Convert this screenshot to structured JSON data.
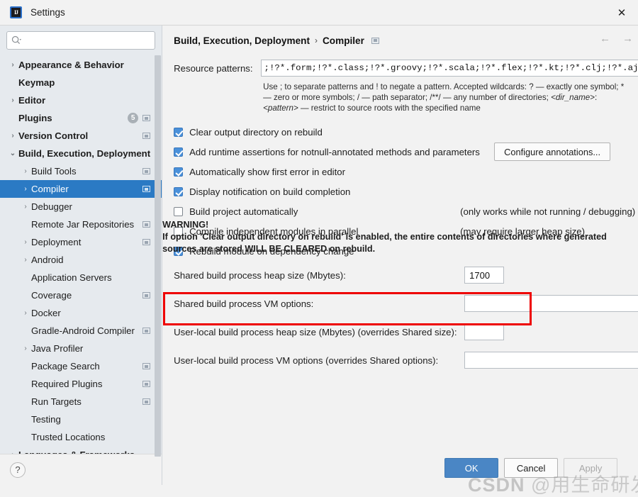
{
  "window": {
    "title": "Settings",
    "app_icon": "intellij-idea-icon",
    "close_label": "✕"
  },
  "sidebar": {
    "search": {
      "value": "",
      "placeholder": "",
      "icon": "search-icon"
    },
    "items": [
      {
        "label": "Appearance & Behavior",
        "arrow": "›",
        "bold": true,
        "indent": 0,
        "monitor": false,
        "badge": null,
        "selected": false
      },
      {
        "label": "Keymap",
        "arrow": "",
        "bold": true,
        "indent": 0,
        "monitor": false,
        "badge": null,
        "selected": false
      },
      {
        "label": "Editor",
        "arrow": "›",
        "bold": true,
        "indent": 0,
        "monitor": false,
        "badge": null,
        "selected": false
      },
      {
        "label": "Plugins",
        "arrow": "",
        "bold": true,
        "indent": 0,
        "monitor": true,
        "badge": "5",
        "selected": false
      },
      {
        "label": "Version Control",
        "arrow": "›",
        "bold": true,
        "indent": 0,
        "monitor": true,
        "badge": null,
        "selected": false
      },
      {
        "label": "Build, Execution, Deployment",
        "arrow": "⌄",
        "bold": true,
        "indent": 0,
        "monitor": false,
        "badge": null,
        "selected": false
      },
      {
        "label": "Build Tools",
        "arrow": "›",
        "bold": false,
        "indent": 1,
        "monitor": true,
        "badge": null,
        "selected": false
      },
      {
        "label": "Compiler",
        "arrow": "›",
        "bold": false,
        "indent": 1,
        "monitor": true,
        "badge": null,
        "selected": true
      },
      {
        "label": "Debugger",
        "arrow": "›",
        "bold": false,
        "indent": 1,
        "monitor": false,
        "badge": null,
        "selected": false
      },
      {
        "label": "Remote Jar Repositories",
        "arrow": "",
        "bold": false,
        "indent": 1,
        "monitor": true,
        "badge": null,
        "selected": false
      },
      {
        "label": "Deployment",
        "arrow": "›",
        "bold": false,
        "indent": 1,
        "monitor": true,
        "badge": null,
        "selected": false
      },
      {
        "label": "Android",
        "arrow": "›",
        "bold": false,
        "indent": 1,
        "monitor": false,
        "badge": null,
        "selected": false
      },
      {
        "label": "Application Servers",
        "arrow": "",
        "bold": false,
        "indent": 1,
        "monitor": false,
        "badge": null,
        "selected": false
      },
      {
        "label": "Coverage",
        "arrow": "",
        "bold": false,
        "indent": 1,
        "monitor": true,
        "badge": null,
        "selected": false
      },
      {
        "label": "Docker",
        "arrow": "›",
        "bold": false,
        "indent": 1,
        "monitor": false,
        "badge": null,
        "selected": false
      },
      {
        "label": "Gradle-Android Compiler",
        "arrow": "",
        "bold": false,
        "indent": 1,
        "monitor": true,
        "badge": null,
        "selected": false
      },
      {
        "label": "Java Profiler",
        "arrow": "›",
        "bold": false,
        "indent": 1,
        "monitor": false,
        "badge": null,
        "selected": false
      },
      {
        "label": "Package Search",
        "arrow": "",
        "bold": false,
        "indent": 1,
        "monitor": true,
        "badge": null,
        "selected": false
      },
      {
        "label": "Required Plugins",
        "arrow": "",
        "bold": false,
        "indent": 1,
        "monitor": true,
        "badge": null,
        "selected": false
      },
      {
        "label": "Run Targets",
        "arrow": "",
        "bold": false,
        "indent": 1,
        "monitor": true,
        "badge": null,
        "selected": false
      },
      {
        "label": "Testing",
        "arrow": "",
        "bold": false,
        "indent": 1,
        "monitor": false,
        "badge": null,
        "selected": false
      },
      {
        "label": "Trusted Locations",
        "arrow": "",
        "bold": false,
        "indent": 1,
        "monitor": false,
        "badge": null,
        "selected": false
      },
      {
        "label": "Languages & Frameworks",
        "arrow": "›",
        "bold": true,
        "indent": 0,
        "monitor": false,
        "badge": null,
        "selected": false
      }
    ],
    "help_button": "?"
  },
  "header": {
    "breadcrumb_root": "Build, Execution, Deployment",
    "breadcrumb_sep": "›",
    "breadcrumb_leaf": "Compiler",
    "project_scope_icon": "project-scope-icon",
    "back_arrow": "←",
    "forward_arrow": "→"
  },
  "main": {
    "resource_patterns": {
      "label": "Resource patterns:",
      "value": ";!?*.form;!?*.class;!?*.groovy;!?*.scala;!?*.flex;!?*.kt;!?*.clj;!?*.aj",
      "expand_icon": "expand-grip-icon"
    },
    "hint_line1": "Use ; to separate patterns and ! to negate a pattern. Accepted wildcards: ? — exactly one symbol; *",
    "hint_line2_a": "— zero or more symbols; / — path separator; /**/ — any number of directories; ",
    "hint_line2_b": "<dir_name>",
    "hint_line2_c": ":",
    "hint_line3_a": "<pattern>",
    "hint_line3_b": " — restrict to source roots with the specified name",
    "checkboxes": [
      {
        "label": "Clear output directory on rebuild",
        "checked": true,
        "note": "",
        "button": ""
      },
      {
        "label": "Add runtime assertions for notnull-annotated methods and parameters",
        "checked": true,
        "note": "",
        "button": "Configure annotations..."
      },
      {
        "label": "Automatically show first error in editor",
        "checked": true,
        "note": "",
        "button": ""
      },
      {
        "label": "Display notification on build completion",
        "checked": true,
        "note": "",
        "button": ""
      },
      {
        "label": "Build project automatically",
        "checked": false,
        "note": "(only works while not running / debugging)",
        "button": ""
      },
      {
        "label": "Compile independent modules in parallel",
        "checked": false,
        "note": "(may require larger heap size)",
        "button": ""
      },
      {
        "label": "Rebuild module on dependency change",
        "checked": true,
        "note": "",
        "button": ""
      }
    ],
    "fields": [
      {
        "label": "Shared build process heap size (Mbytes):",
        "value": "1700",
        "size": "small",
        "grip": false
      },
      {
        "label": "Shared build process VM options:",
        "value": "",
        "size": "wide",
        "grip": true
      },
      {
        "label": "User-local build process heap size (Mbytes) (overrides Shared size):",
        "value": "",
        "size": "small",
        "grip": false
      },
      {
        "label": "User-local build process VM options (overrides Shared options):",
        "value": "",
        "size": "wide",
        "grip": true
      }
    ],
    "warning": {
      "title": "WARNING!",
      "line1": "If option 'Clear output directory on rebuild' is enabled, the entire contents of directories where generated",
      "line2": "sources are stored WILL BE CLEARED on rebuild."
    },
    "highlight_color": "#ee0000"
  },
  "footer": {
    "ok_label": "OK",
    "cancel_label": "Cancel",
    "apply_label": "Apply"
  },
  "watermark": {
    "brand": "CSDN",
    "text": " @用生命研发技术"
  }
}
